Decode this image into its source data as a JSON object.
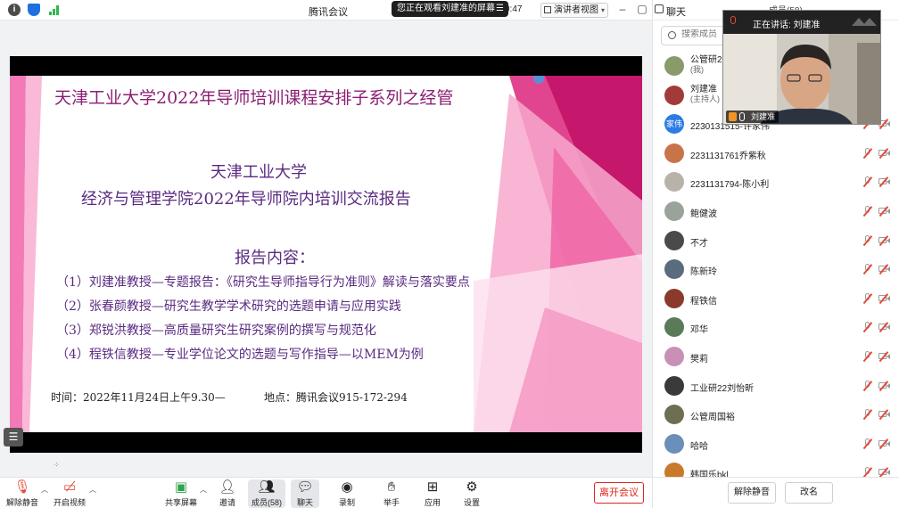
{
  "window": {
    "title": "腾讯会议",
    "watching_notice": "您正在观看刘建准的屏幕",
    "timer": "0:47",
    "view_mode": "演讲者视图"
  },
  "slide": {
    "title": "天津工业大学2022年导师培训课程安排子系列之经管",
    "heading1": "天津工业大学",
    "heading2": "经济与管理学院2022年导师院内培训交流报告",
    "heading3": "报告内容：",
    "items": [
      "（1）刘建准教授—专题报告：《研究生导师指导行为准则》解读与落实要点",
      "（2）张春颜教授—研究生教学学术研究的选题申请与应用实践",
      "（3）郑锐洪教授—高质量研究生研究案例的撰写与规范化",
      "（4）程铁信教授—专业学位论文的选题与写作指导—以MEM为例"
    ],
    "time": "时间：2022年11月24日上午9.30—",
    "place": "地点：腾讯会议915-172-294"
  },
  "toolbar": {
    "unmute": "解除静音",
    "start_video": "开启视频",
    "share_screen": "共享屏幕",
    "invite": "邀请",
    "members": "成员(58)",
    "chat": "聊天",
    "record": "录制",
    "raise_hand": "举手",
    "apps": "应用",
    "settings": "设置",
    "leave": "离开会议"
  },
  "panel": {
    "chat_tab": "聊天",
    "members_tab": "成员(58)",
    "search_placeholder": "搜索成员",
    "members": [
      {
        "name": "公管研22",
        "sub": "(我)",
        "avatar_color": "#8a9a6a",
        "muted": false
      },
      {
        "name": "刘建准",
        "sub": "(主持人)",
        "avatar_color": "#a23a3a",
        "muted": false
      },
      {
        "name": "2230131515-许家伟",
        "sub": "",
        "avatar_color": "#2d7be5",
        "avatar_text": "家伟",
        "muted": true
      },
      {
        "name": "2231131761乔紫秋",
        "sub": "",
        "avatar_color": "#c8734a",
        "muted": true
      },
      {
        "name": "2231131794-陈小利",
        "sub": "",
        "avatar_color": "#b9b2a8",
        "muted": true
      },
      {
        "name": "鲍健波",
        "sub": "",
        "avatar_color": "#9aa39a",
        "muted": true
      },
      {
        "name": "不才",
        "sub": "",
        "avatar_color": "#4a4a4a",
        "muted": true
      },
      {
        "name": "陈新玲",
        "sub": "",
        "avatar_color": "#5b6b7e",
        "muted": true
      },
      {
        "name": "程铁信",
        "sub": "",
        "avatar_color": "#8a3a2a",
        "muted": true
      },
      {
        "name": "邓华",
        "sub": "",
        "avatar_color": "#5a7a5a",
        "muted": true
      },
      {
        "name": "樊莉",
        "sub": "",
        "avatar_color": "#c98fb5",
        "muted": true
      },
      {
        "name": "工业研22刘怡昕",
        "sub": "",
        "avatar_color": "#3a3a3a",
        "muted": true
      },
      {
        "name": "公管周国裕",
        "sub": "",
        "avatar_color": "#6e6e52",
        "muted": true
      },
      {
        "name": "哈哈",
        "sub": "",
        "avatar_color": "#6a8fb8",
        "muted": true
      },
      {
        "name": "韩国乐bkl",
        "sub": "",
        "avatar_color": "#c87a2a",
        "muted": true
      }
    ],
    "unmute_all": "解除静音",
    "rename": "改名"
  },
  "speaker": {
    "speaking_label": "正在讲话: 刘建准",
    "name": "刘建准"
  },
  "colors": {
    "slide_title": "#8b1f73",
    "slide_heading": "#5a2a80",
    "leave": "#e1251b",
    "muted_slash": "#e24b3b"
  }
}
